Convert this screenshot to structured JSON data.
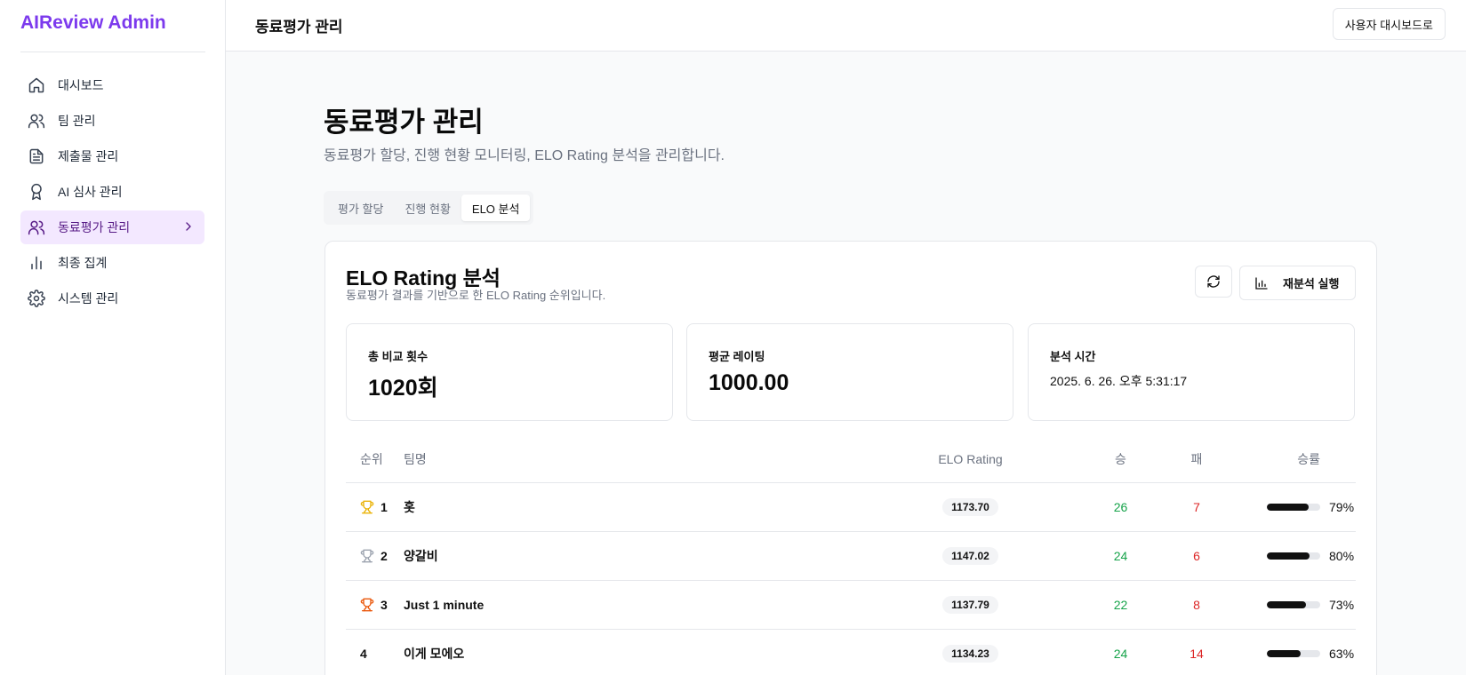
{
  "app": {
    "brand": "AIReview Admin"
  },
  "sidebar": {
    "items": [
      {
        "label": "대시보드",
        "icon": "home-icon"
      },
      {
        "label": "팀 관리",
        "icon": "users-icon"
      },
      {
        "label": "제출물 관리",
        "icon": "file-text-icon"
      },
      {
        "label": "AI 심사 관리",
        "icon": "award-icon"
      },
      {
        "label": "동료평가 관리",
        "icon": "users-icon",
        "active": true
      },
      {
        "label": "최종 집계",
        "icon": "bar-chart-icon"
      },
      {
        "label": "시스템 관리",
        "icon": "settings-icon"
      }
    ]
  },
  "header": {
    "title": "동료평가 관리",
    "user_dashboard_label": "사용자 대시보드로"
  },
  "page": {
    "title": "동료평가 관리",
    "description": "동료평가 할당, 진행 현황 모니터링, ELO Rating 분석을 관리합니다."
  },
  "tabs": [
    {
      "label": "평가 할당"
    },
    {
      "label": "진행 현황"
    },
    {
      "label": "ELO 분석",
      "active": true
    }
  ],
  "elo": {
    "title": "ELO Rating 분석",
    "description": "동료평가 결과를 기반으로 한 ELO Rating 순위입니다.",
    "reanalyze_label": "재분석 실행",
    "stats": {
      "total_label": "총 비교 횟수",
      "total_value": "1020회",
      "avg_label": "평균 레이팅",
      "avg_value": "1000.00",
      "time_label": "분석 시간",
      "time_value": "2025. 6. 26. 오후 5:31:17"
    },
    "columns": {
      "rank": "순위",
      "team": "팀명",
      "elo": "ELO Rating",
      "win": "승",
      "loss": "패",
      "rate": "승률"
    },
    "rows": [
      {
        "rank": "1",
        "team": "홋",
        "elo": "1173.70",
        "win": "26",
        "loss": "7",
        "rate": "79%",
        "rate_value": 0.79,
        "trophy": "gold"
      },
      {
        "rank": "2",
        "team": "양갈비",
        "elo": "1147.02",
        "win": "24",
        "loss": "6",
        "rate": "80%",
        "rate_value": 0.8,
        "trophy": "silver"
      },
      {
        "rank": "3",
        "team": "Just 1 minute",
        "elo": "1137.79",
        "win": "22",
        "loss": "8",
        "rate": "73%",
        "rate_value": 0.73,
        "trophy": "bronze"
      },
      {
        "rank": "4",
        "team": "이게 모에오",
        "elo": "1134.23",
        "win": "24",
        "loss": "14",
        "rate": "63%",
        "rate_value": 0.63,
        "trophy": ""
      }
    ]
  },
  "colors": {
    "brand": "#7c3aed",
    "active_nav_bg": "#f3e8ff",
    "win": "#16a34a",
    "loss": "#dc2626",
    "trophy_gold": "#eab308",
    "trophy_silver": "#9ca3af",
    "trophy_bronze": "#ea580c"
  }
}
